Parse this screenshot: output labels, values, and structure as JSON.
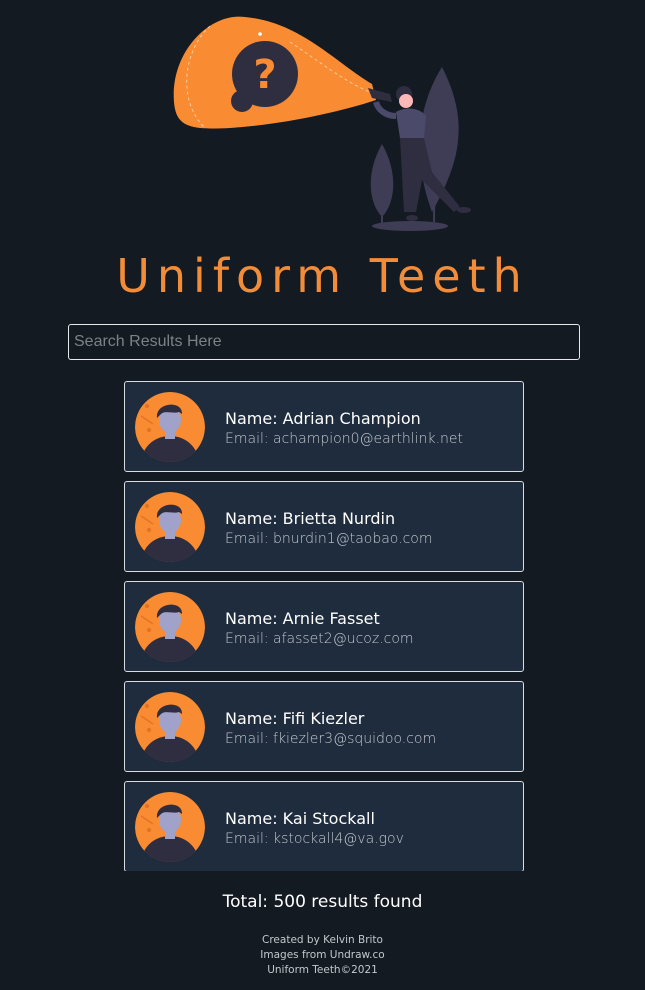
{
  "header": {
    "title": "Uniform Teeth"
  },
  "search": {
    "placeholder": "Search Results Here"
  },
  "results": [
    {
      "name": "Name: Adrian Champion",
      "email": "Email: achampion0@earthlink.net"
    },
    {
      "name": "Name: Brietta Nurdin",
      "email": "Email: bnurdin1@taobao.com"
    },
    {
      "name": "Name: Arnie Fasset",
      "email": "Email: afasset2@ucoz.com"
    },
    {
      "name": "Name: Fifi Kiezler",
      "email": "Email: fkiezler3@squidoo.com"
    },
    {
      "name": "Name: Kai Stockall",
      "email": "Email: kstockall4@va.gov"
    }
  ],
  "summary": {
    "total_text": "Total: 500 results found"
  },
  "footer": {
    "credit": "Created by Kelvin Brito",
    "images": "Images from Undraw.co",
    "copyright": "Uniform Teeth©2021"
  },
  "colors": {
    "background": "#141a21",
    "accent": "#f28c38",
    "card_background": "#1e2c3d",
    "card_border": "#d9dde1",
    "text_primary": "#ffffff"
  },
  "icons": {
    "hero": "searchlight-question-illustration",
    "avatar": "user-avatar-icon"
  }
}
